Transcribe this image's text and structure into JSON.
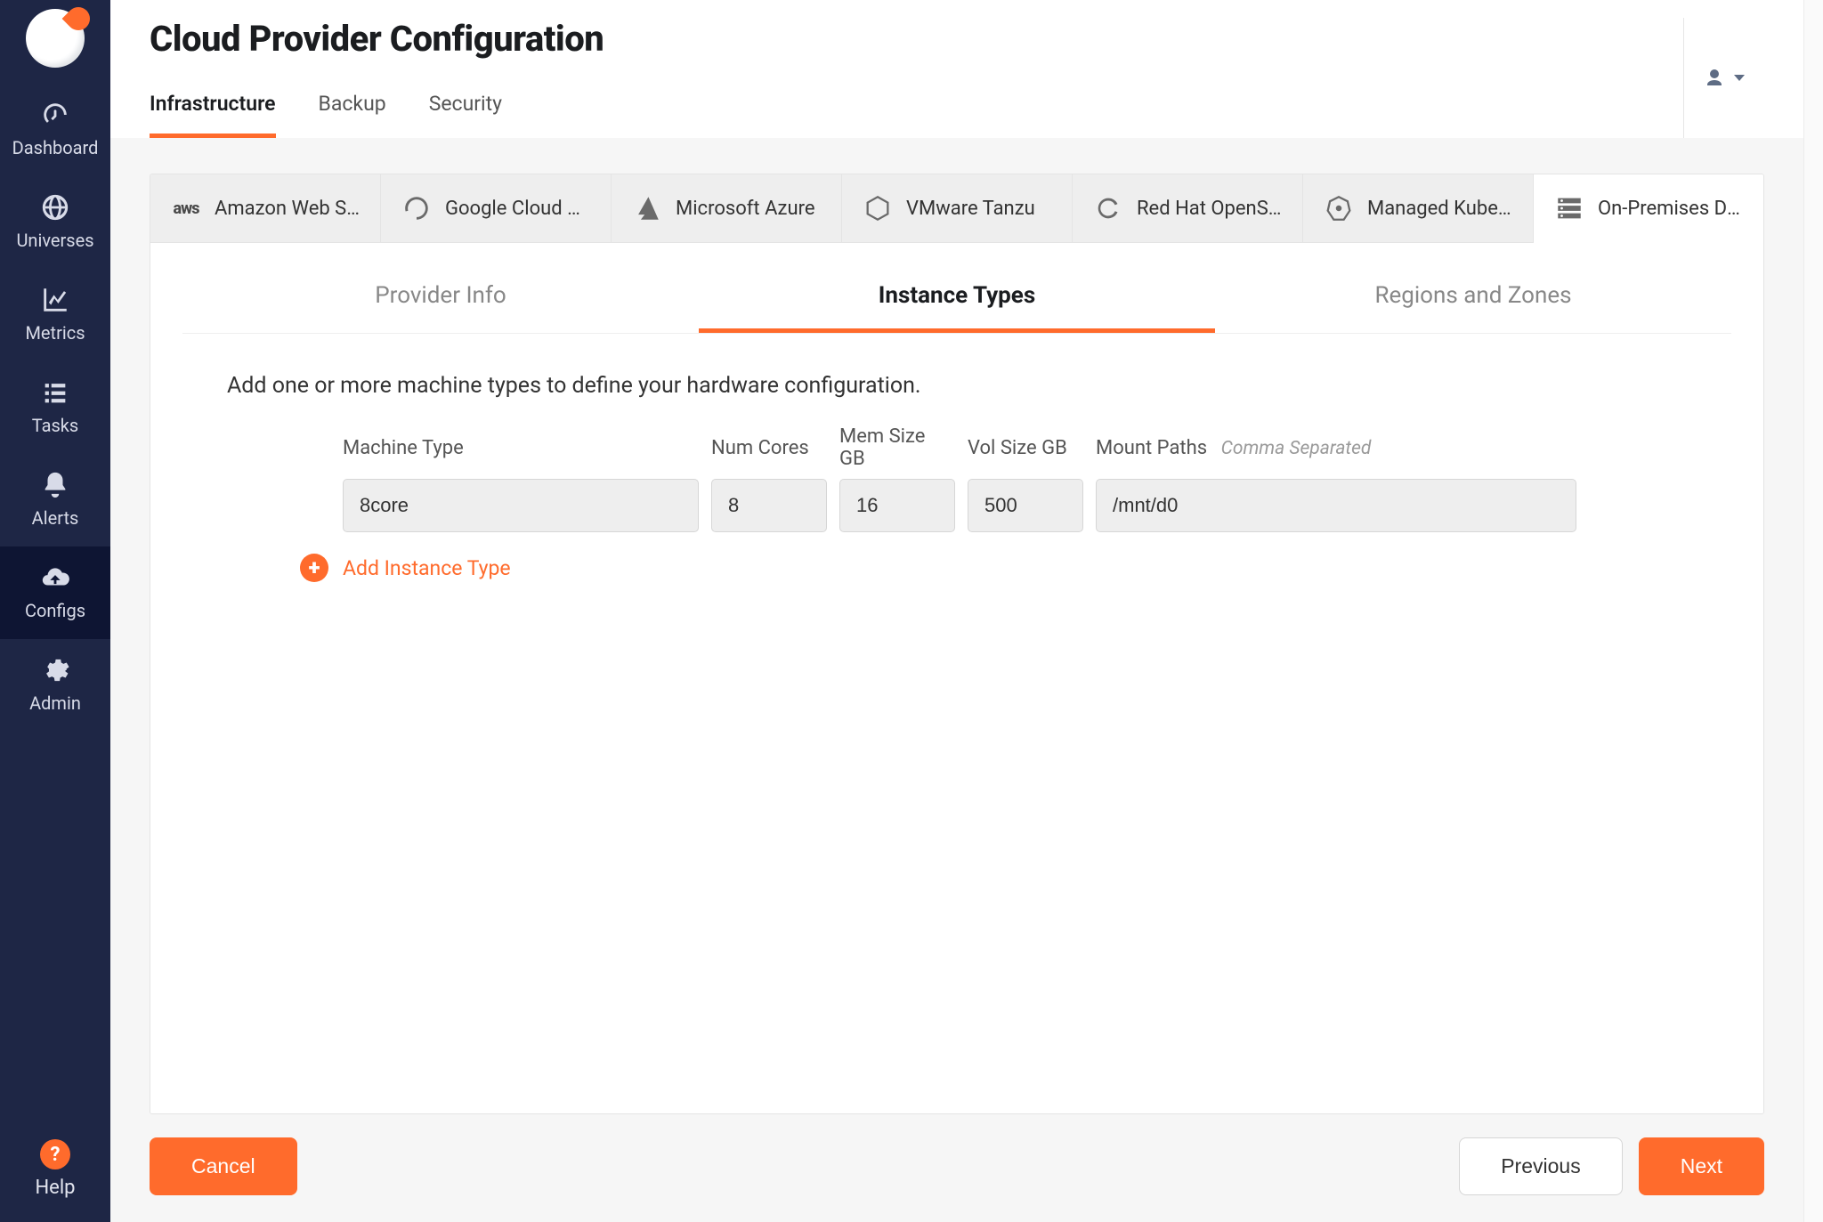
{
  "sidebar": {
    "items": [
      {
        "label": "Dashboard"
      },
      {
        "label": "Universes"
      },
      {
        "label": "Metrics"
      },
      {
        "label": "Tasks"
      },
      {
        "label": "Alerts"
      },
      {
        "label": "Configs"
      },
      {
        "label": "Admin"
      }
    ],
    "help_label": "Help"
  },
  "header": {
    "title": "Cloud Provider Configuration",
    "tabs": [
      {
        "label": "Infrastructure",
        "active": true
      },
      {
        "label": "Backup",
        "active": false
      },
      {
        "label": "Security",
        "active": false
      }
    ]
  },
  "providers": [
    {
      "label": "Amazon Web Se…"
    },
    {
      "label": "Google Cloud Pl…"
    },
    {
      "label": "Microsoft Azure"
    },
    {
      "label": "VMware Tanzu"
    },
    {
      "label": "Red Hat OpenShift"
    },
    {
      "label": "Managed Kuber…"
    },
    {
      "label": "On-Premises Dat…"
    }
  ],
  "steps": [
    {
      "label": "Provider Info"
    },
    {
      "label": "Instance Types"
    },
    {
      "label": "Regions and Zones"
    }
  ],
  "instruction": "Add one or more machine types to define your hardware configuration.",
  "columns": {
    "machine_type": "Machine Type",
    "num_cores": "Num Cores",
    "mem_size": "Mem Size GB",
    "vol_size": "Vol Size GB",
    "mount_paths": "Mount Paths",
    "mount_paths_hint": "Comma Separated"
  },
  "row": {
    "machine_type": "8core",
    "num_cores": "8",
    "mem_size": "16",
    "vol_size": "500",
    "mount_paths": "/mnt/d0"
  },
  "add_row_label": "Add Instance Type",
  "buttons": {
    "cancel": "Cancel",
    "previous": "Previous",
    "next": "Next"
  }
}
